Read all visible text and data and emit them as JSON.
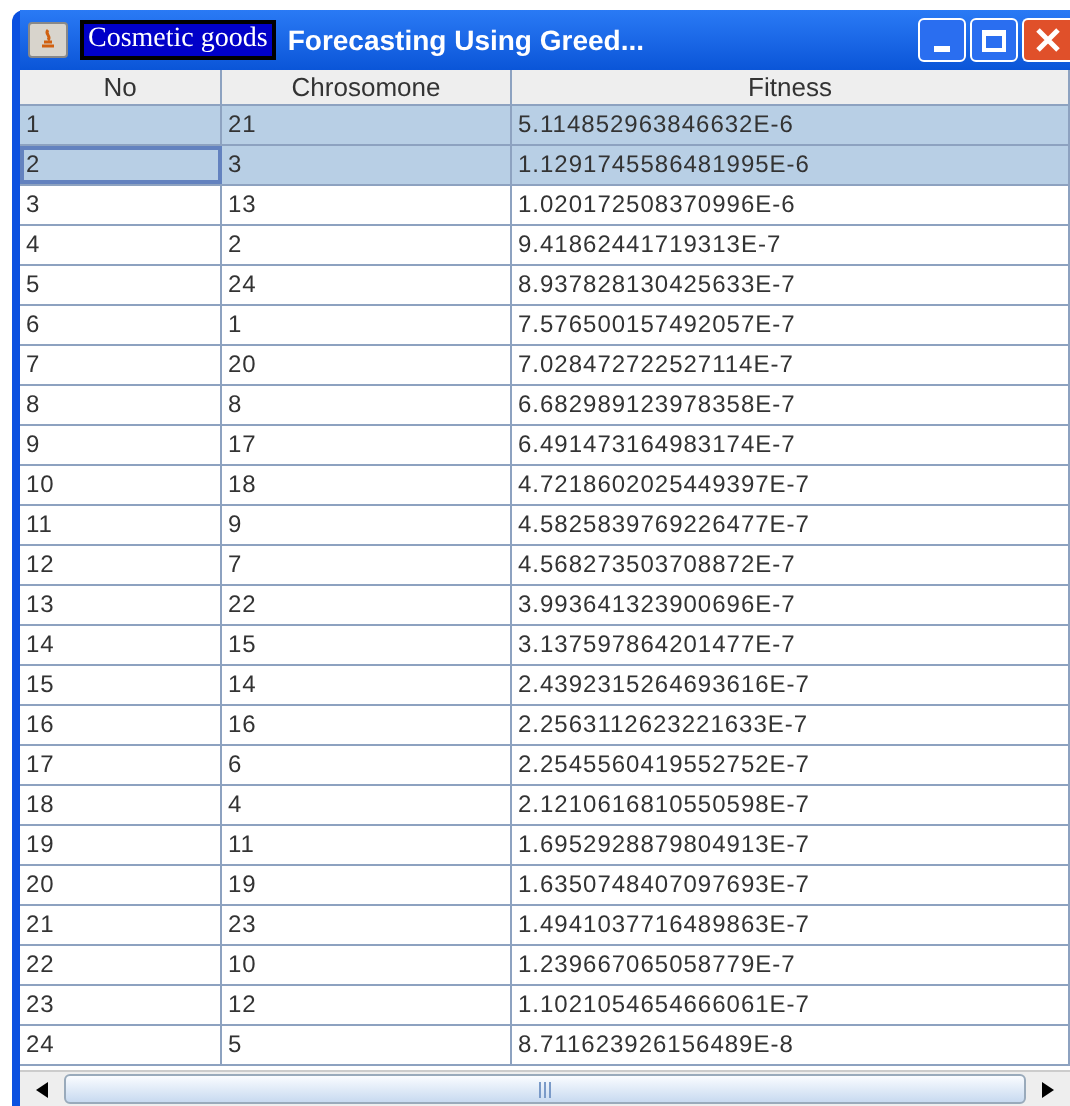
{
  "window": {
    "title_selection": "Cosmetic goods",
    "title": "Forecasting Using Greed..."
  },
  "table": {
    "columns": [
      "No",
      "Chrosomone",
      "Fitness"
    ],
    "rows": [
      {
        "cells": [
          "1",
          "21",
          "5.114852963846632E-6"
        ],
        "selected": true,
        "focused": false
      },
      {
        "cells": [
          "2",
          "3",
          "1.1291745586481995E-6"
        ],
        "selected": true,
        "focused": true
      },
      {
        "cells": [
          "3",
          "13",
          "1.020172508370996E-6"
        ],
        "selected": false,
        "focused": false
      },
      {
        "cells": [
          "4",
          "2",
          "9.41862441719313E-7"
        ],
        "selected": false,
        "focused": false
      },
      {
        "cells": [
          "5",
          "24",
          "8.937828130425633E-7"
        ],
        "selected": false,
        "focused": false
      },
      {
        "cells": [
          "6",
          "1",
          "7.576500157492057E-7"
        ],
        "selected": false,
        "focused": false
      },
      {
        "cells": [
          "7",
          "20",
          "7.028472722527114E-7"
        ],
        "selected": false,
        "focused": false
      },
      {
        "cells": [
          "8",
          "8",
          "6.682989123978358E-7"
        ],
        "selected": false,
        "focused": false
      },
      {
        "cells": [
          "9",
          "17",
          "6.491473164983174E-7"
        ],
        "selected": false,
        "focused": false
      },
      {
        "cells": [
          "10",
          "18",
          "4.7218602025449397E-7"
        ],
        "selected": false,
        "focused": false
      },
      {
        "cells": [
          "11",
          "9",
          "4.5825839769226477E-7"
        ],
        "selected": false,
        "focused": false
      },
      {
        "cells": [
          "12",
          "7",
          "4.568273503708872E-7"
        ],
        "selected": false,
        "focused": false
      },
      {
        "cells": [
          "13",
          "22",
          "3.993641323900696E-7"
        ],
        "selected": false,
        "focused": false
      },
      {
        "cells": [
          "14",
          "15",
          "3.137597864201477E-7"
        ],
        "selected": false,
        "focused": false
      },
      {
        "cells": [
          "15",
          "14",
          "2.4392315264693616E-7"
        ],
        "selected": false,
        "focused": false
      },
      {
        "cells": [
          "16",
          "16",
          "2.2563112623221633E-7"
        ],
        "selected": false,
        "focused": false
      },
      {
        "cells": [
          "17",
          "6",
          "2.2545560419552752E-7"
        ],
        "selected": false,
        "focused": false
      },
      {
        "cells": [
          "18",
          "4",
          "2.1210616810550598E-7"
        ],
        "selected": false,
        "focused": false
      },
      {
        "cells": [
          "19",
          "11",
          "1.6952928879804913E-7"
        ],
        "selected": false,
        "focused": false
      },
      {
        "cells": [
          "20",
          "19",
          "1.6350748407097693E-7"
        ],
        "selected": false,
        "focused": false
      },
      {
        "cells": [
          "21",
          "23",
          "1.4941037716489863E-7"
        ],
        "selected": false,
        "focused": false
      },
      {
        "cells": [
          "22",
          "10",
          "1.239667065058779E-7"
        ],
        "selected": false,
        "focused": false
      },
      {
        "cells": [
          "23",
          "12",
          "1.1021054654666061E-7"
        ],
        "selected": false,
        "focused": false
      },
      {
        "cells": [
          "24",
          "5",
          "8.711623926156489E-8"
        ],
        "selected": false,
        "focused": false
      }
    ]
  }
}
